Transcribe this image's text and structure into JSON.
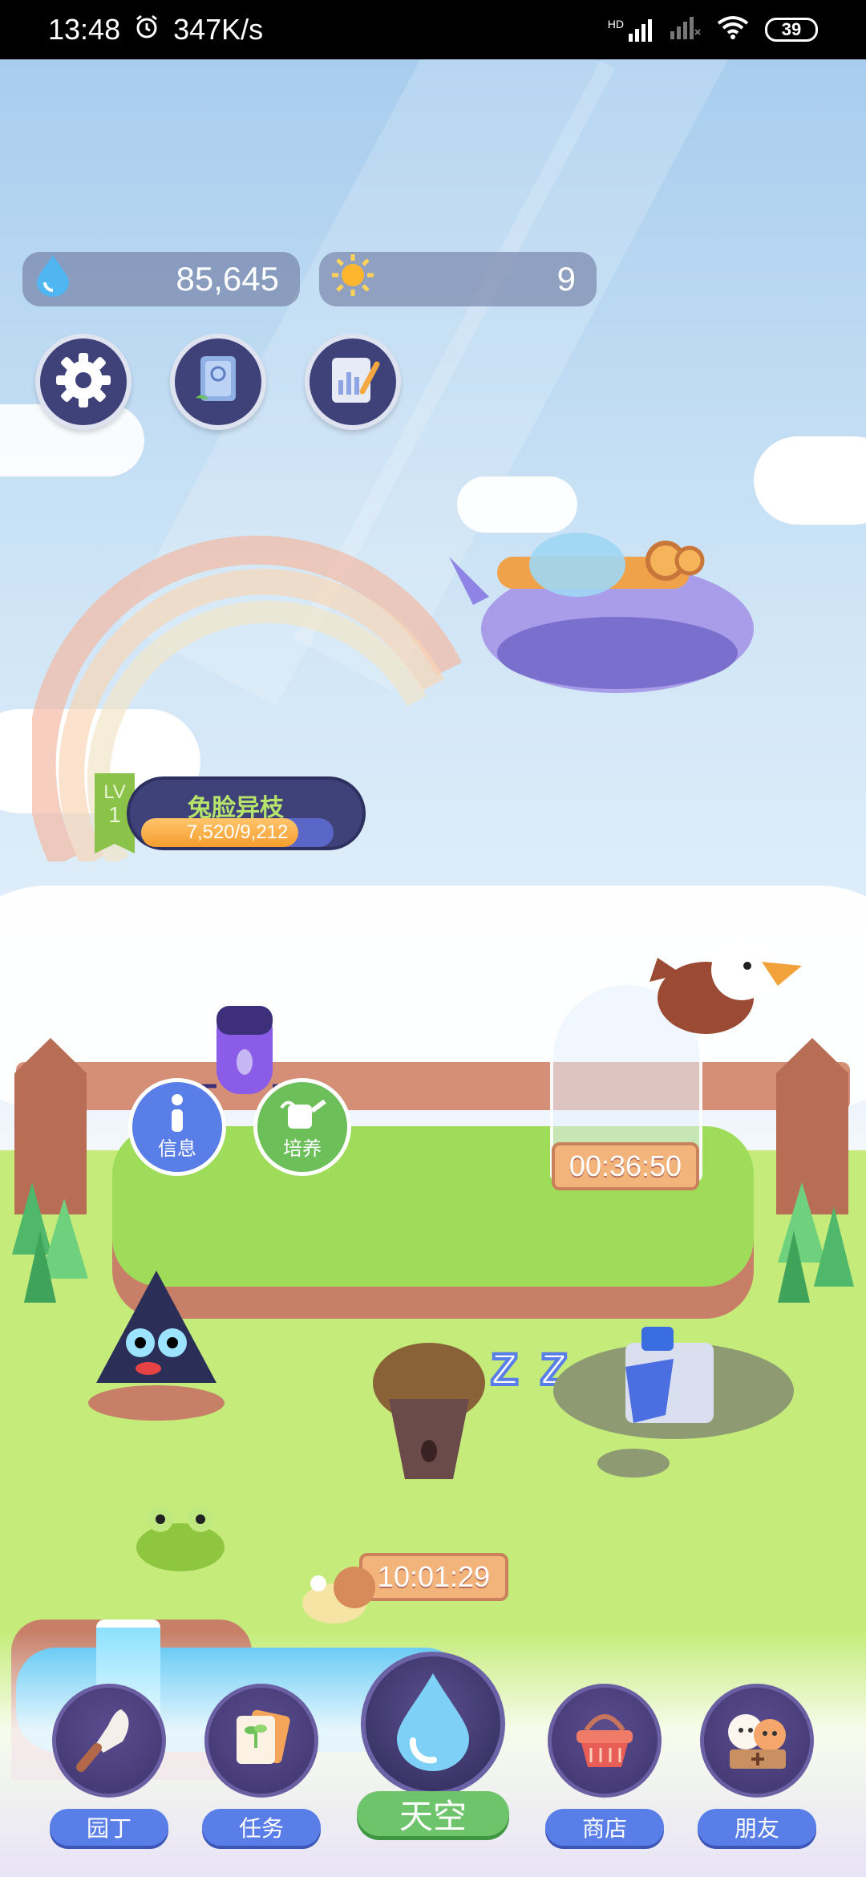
{
  "status_bar": {
    "time": "13:48",
    "speed": "347K/s",
    "network": "HD",
    "battery": "39"
  },
  "resources": {
    "water": {
      "icon": "water-drop-icon",
      "value": "85,645"
    },
    "sun": {
      "icon": "sun-icon",
      "value": "9"
    }
  },
  "toolbar": {
    "buttons": [
      {
        "name": "settings",
        "icon": "gear-icon"
      },
      {
        "name": "guide",
        "icon": "book-icon"
      },
      {
        "name": "notes",
        "icon": "clipboard-icon"
      }
    ]
  },
  "plant": {
    "level_label": "LV",
    "level": "1",
    "name": "兔脸异枝",
    "xp_text": "7,520/9,212",
    "xp_fraction": 0.816
  },
  "island_actions": {
    "info_label": "信息",
    "cultivate_label": "培养"
  },
  "timers": {
    "dome_timer": "00:36:50",
    "sprout_timer": "10:01:29"
  },
  "sleep_text": "Z Z",
  "bottom_nav": {
    "gardener": "园丁",
    "tasks": "任务",
    "sky": "天空",
    "shop": "商店",
    "friends": "朋友"
  },
  "colors": {
    "accent_blue": "#5a7ee8",
    "accent_green": "#6dc46a",
    "panel_navy": "#3f4279"
  }
}
